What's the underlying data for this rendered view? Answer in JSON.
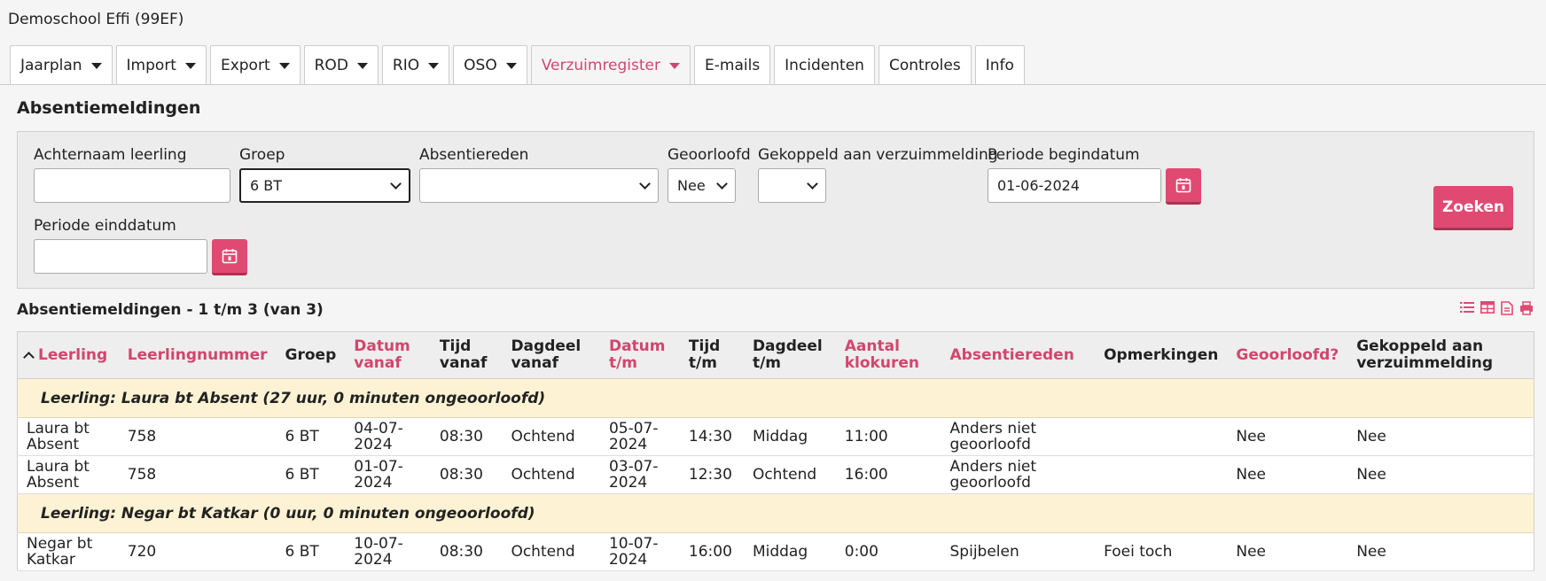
{
  "school": "Demoschool Effi (99EF)",
  "tabs": [
    {
      "label": "Jaarplan",
      "dropdown": true
    },
    {
      "label": "Import",
      "dropdown": true
    },
    {
      "label": "Export",
      "dropdown": true
    },
    {
      "label": "ROD",
      "dropdown": true
    },
    {
      "label": "RIO",
      "dropdown": true
    },
    {
      "label": "OSO",
      "dropdown": true
    },
    {
      "label": "Verzuimregister",
      "dropdown": true,
      "active": true
    },
    {
      "label": "E-mails",
      "dropdown": false
    },
    {
      "label": "Incidenten",
      "dropdown": false
    },
    {
      "label": "Controles",
      "dropdown": false
    },
    {
      "label": "Info",
      "dropdown": false
    }
  ],
  "page_title": "Absentiemeldingen",
  "filters": {
    "achternaam_label": "Achternaam leerling",
    "achternaam_value": "",
    "groep_label": "Groep",
    "groep_value": "6 BT",
    "absentiereden_label": "Absentiereden",
    "absentiereden_value": "",
    "geoorloofd_label": "Geoorloofd",
    "geoorloofd_value": "Nee",
    "gekoppeld_label": "Gekoppeld aan verzuimmelding",
    "gekoppeld_value": "",
    "begindatum_label": "Periode begindatum",
    "begindatum_value": "01-06-2024",
    "einddatum_label": "Periode einddatum",
    "einddatum_value": "",
    "search_label": "Zoeken"
  },
  "results_title": "Absentiemeldingen - 1 t/m 3 (van 3)",
  "table": {
    "headers": {
      "leerling": "Leerling",
      "leerlingnummer": "Leerlingnummer",
      "groep": "Groep",
      "datum_vanaf": "Datum vanaf",
      "tijd_vanaf": "Tijd vanaf",
      "dagdeel_vanaf": "Dagdeel vanaf",
      "datum_tm": "Datum t/m",
      "tijd_tm": "Tijd t/m",
      "dagdeel_tm": "Dagdeel t/m",
      "aantal_klokuren": "Aantal klokuren",
      "absentiereden": "Absentiereden",
      "opmerkingen": "Opmerkingen",
      "geoorloofd": "Geoorloofd?",
      "gekoppeld": "Gekoppeld aan verzuimmelding"
    },
    "group1": "Leerling: Laura bt Absent (27 uur, 0 minuten ongeoorloofd)",
    "group2": "Leerling: Negar bt Katkar (0 uur, 0 minuten ongeoorloofd)",
    "rows": [
      {
        "leerling": "Laura bt Absent",
        "nummer": "758",
        "groep": "6 BT",
        "datum_vanaf": "04-07-2024",
        "tijd_vanaf": "08:30",
        "dagdeel_vanaf": "Ochtend",
        "datum_tm": "05-07-2024",
        "tijd_tm": "14:30",
        "dagdeel_tm": "Middag",
        "klokuren": "11:00",
        "reden": "Anders niet geoorloofd",
        "opmerkingen": "",
        "geoorloofd": "Nee",
        "gekoppeld": "Nee"
      },
      {
        "leerling": "Laura bt Absent",
        "nummer": "758",
        "groep": "6 BT",
        "datum_vanaf": "01-07-2024",
        "tijd_vanaf": "08:30",
        "dagdeel_vanaf": "Ochtend",
        "datum_tm": "03-07-2024",
        "tijd_tm": "12:30",
        "dagdeel_tm": "Ochtend",
        "klokuren": "16:00",
        "reden": "Anders niet geoorloofd",
        "opmerkingen": "",
        "geoorloofd": "Nee",
        "gekoppeld": "Nee"
      },
      {
        "leerling": "Negar bt Katkar",
        "nummer": "720",
        "groep": "6 BT",
        "datum_vanaf": "10-07-2024",
        "tijd_vanaf": "08:30",
        "dagdeel_vanaf": "Ochtend",
        "datum_tm": "10-07-2024",
        "tijd_tm": "16:00",
        "dagdeel_tm": "Middag",
        "klokuren": "0:00",
        "reden": "Spijbelen",
        "opmerkingen": "Foei toch",
        "geoorloofd": "Nee",
        "gekoppeld": "Nee"
      }
    ]
  },
  "colors": {
    "accent": "#e04a72",
    "accent_text": "#d1466e",
    "group_row": "#fdf3d4"
  }
}
